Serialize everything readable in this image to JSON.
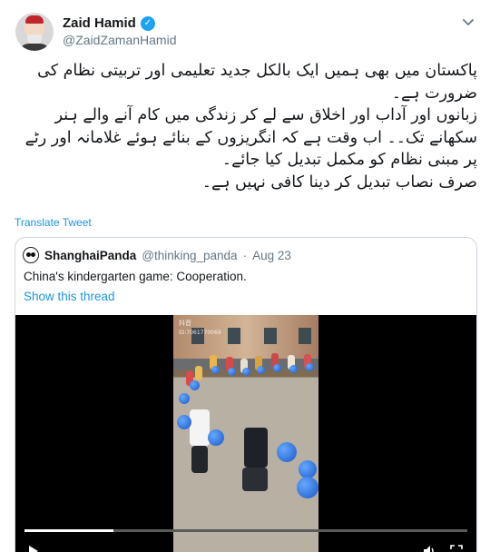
{
  "author": {
    "name": "Zaid Hamid",
    "handle": "@ZaidZamanHamid",
    "verified": true
  },
  "tweet": {
    "text": "پاکستان میں بھی ہمیں ایک بالکل جدید تعلیمی اور تربیتی نظام کی ضرورت ہے۔\nزبانوں اور آداب اور اخلاق سے لے کر زندگی میں کام آنے والے ہنر سکھانے تک۔۔ اب وقت ہے کہ انگریزوں کے بنائے ہوئے غلامانہ اور رٹے پر مبنی نظام کو مکمل تبدیل کیا جائے۔\nصرف نصاب تبدیل کر دینا کافی نہیں ہے۔",
    "translate_label": "Translate Tweet"
  },
  "quoted": {
    "name": "ShanghaiPanda",
    "handle": "@thinking_panda",
    "separator": "·",
    "date": "Aug 23",
    "text": "China's kindergarten game: Cooperation.",
    "show_thread": "Show this thread",
    "video": {
      "watermark": "抖音",
      "watermark_id": "ID:7061770069",
      "progress": 0.2
    }
  },
  "icons": {
    "verified": "verified-badge-icon",
    "menu": "chevron-down-icon",
    "play": "play-icon",
    "volume": "volume-icon",
    "fullscreen": "fullscreen-icon"
  },
  "colors": {
    "link": "#1b95e0",
    "verified": "#1da1f2",
    "muted": "#657786",
    "border": "#ccd6dd"
  }
}
